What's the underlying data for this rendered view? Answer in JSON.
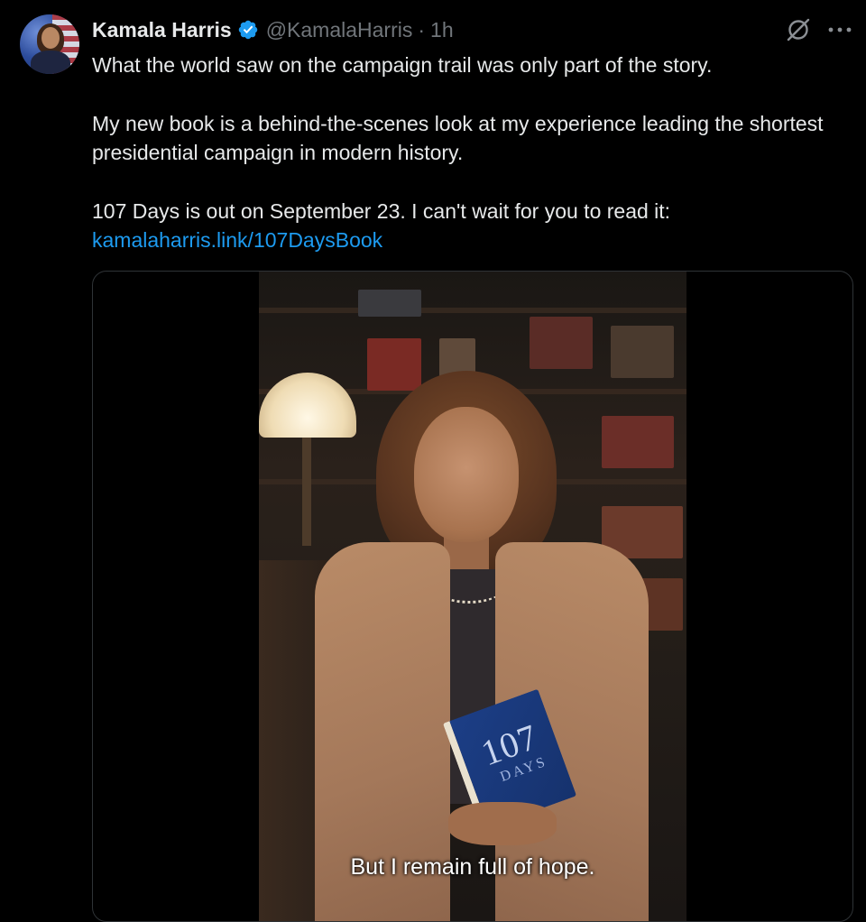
{
  "author": {
    "name": "Kamala Harris",
    "handle": "@KamalaHarris",
    "separator": "·",
    "time": "1h",
    "verified": true
  },
  "tweet": {
    "line1": "What the world saw on the campaign trail was only part of the story.",
    "line2": "My new book is a behind-the-scenes look at my experience leading the shortest presidential campaign in modern history.",
    "line3": "107 Days is out on September 23. I can't wait for you to read it:",
    "link_text": "kamalaharris.link/107DaysBook"
  },
  "media": {
    "caption": "But I remain full of hope.",
    "book_cover_title": "107",
    "book_cover_subtitle": "DAYS"
  },
  "icons": {
    "verified": "verified-badge-icon",
    "grok": "grok-icon",
    "more": "more-options-icon"
  },
  "colors": {
    "background": "#000000",
    "text": "#e7e9ea",
    "secondary": "#71767b",
    "link": "#1d9bf0",
    "verified": "#1d9bf0"
  }
}
